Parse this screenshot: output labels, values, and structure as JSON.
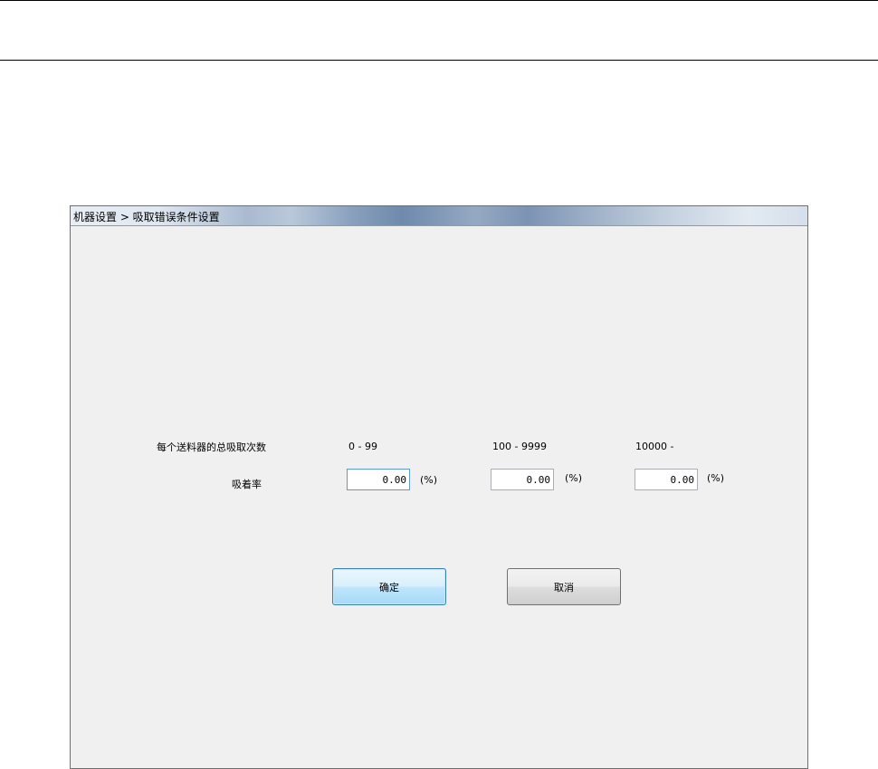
{
  "window": {
    "title": "机器设置 >  吸取错误条件设置"
  },
  "form": {
    "row_label_total": "每个送料器的总吸取次数",
    "row_label_rate": "吸着率",
    "ranges": [
      "0 - 99",
      "100 - 9999",
      "10000 -"
    ],
    "values": [
      "0.00",
      "0.00",
      "0.00"
    ],
    "unit": "(%)"
  },
  "buttons": {
    "ok_label": "确定",
    "cancel_label": "取消"
  }
}
